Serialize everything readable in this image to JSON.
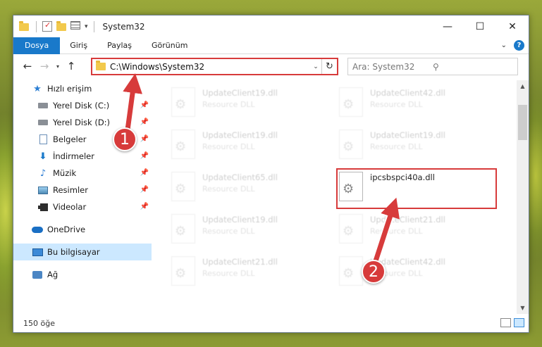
{
  "window": {
    "title": "System32",
    "controls": {
      "minimize": "—",
      "maximize": "☐",
      "close": "✕"
    }
  },
  "ribbon": {
    "tabs": [
      "Dosya",
      "Giriş",
      "Paylaş",
      "Görünüm"
    ]
  },
  "address": {
    "path": "C:\\Windows\\System32",
    "search_placeholder": "Ara: System32"
  },
  "navpane": {
    "quick_access": "Hızlı erişim",
    "items": [
      {
        "label": "Yerel Disk (C:)",
        "icon": "drive-icon",
        "pinned": true
      },
      {
        "label": "Yerel Disk (D:)",
        "icon": "drive-icon",
        "pinned": true
      },
      {
        "label": "Belgeler",
        "icon": "documents-icon",
        "pinned": true
      },
      {
        "label": "İndirmeler",
        "icon": "downloads-icon",
        "pinned": true
      },
      {
        "label": "Müzik",
        "icon": "music-icon",
        "pinned": true
      },
      {
        "label": "Resimler",
        "icon": "pictures-icon",
        "pinned": true
      },
      {
        "label": "Videolar",
        "icon": "videos-icon",
        "pinned": true
      }
    ],
    "onedrive": "OneDrive",
    "this_pc": "Bu bilgisayar",
    "network": "Ağ"
  },
  "files": {
    "left_column": [
      {
        "name": "UpdateClient19.dll",
        "type": "Resource DLL"
      },
      {
        "name": "UpdateClient19.dll",
        "type": "Resource DLL"
      },
      {
        "name": "UpdateClient65.dll",
        "type": "Resource DLL"
      },
      {
        "name": "UpdateClient19.dll",
        "type": "Resource DLL"
      },
      {
        "name": "UpdateClient21.dll",
        "type": "Resource DLL"
      }
    ],
    "right_column": [
      {
        "name": "UpdateClient42.dll",
        "type": "Resource DLL"
      },
      {
        "name": "UpdateClient19.dll",
        "type": "Resource DLL"
      },
      {
        "name": "ipcsbspci40a.dll",
        "type": ""
      },
      {
        "name": "UpdateClient21.dll",
        "type": "Resource DLL"
      },
      {
        "name": "UpdateClient42.dll",
        "type": "Resource DLL"
      }
    ]
  },
  "status": {
    "count": "150 öğe"
  },
  "annotations": {
    "step1": "1",
    "step2": "2"
  },
  "colors": {
    "accent": "#1979ca",
    "highlight": "#d73b3b",
    "selected": "#cce8ff"
  }
}
